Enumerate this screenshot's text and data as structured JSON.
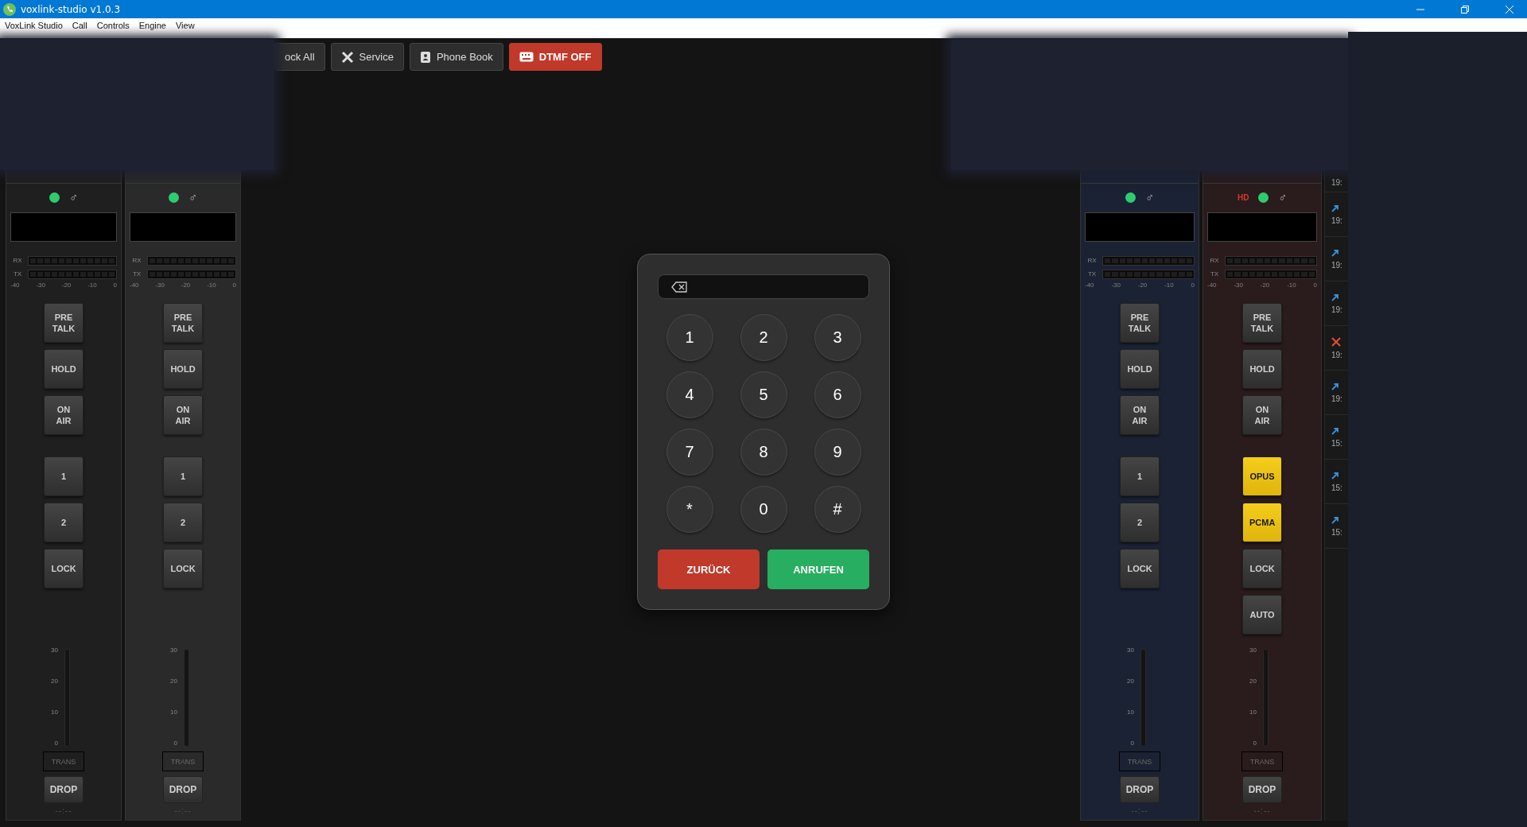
{
  "window": {
    "title": "voxlink-studio v1.0.3"
  },
  "menu": [
    "VoxLink Studio",
    "Call",
    "Controls",
    "Engine",
    "View"
  ],
  "toolbar": [
    {
      "label": "ock All",
      "kind": "plain"
    },
    {
      "label": "Service",
      "kind": "service"
    },
    {
      "label": "Phone Book",
      "kind": "phonebook"
    },
    {
      "label": "DTMF OFF",
      "kind": "dtmf"
    }
  ],
  "channels_left": [
    {
      "color": "#1f1f1f",
      "online": true,
      "user_symbol": "♂",
      "meters": [
        "RX",
        "TX"
      ],
      "scale": [
        "-40",
        "-30",
        "-20",
        "-10",
        "0"
      ],
      "call_buttons": [
        {
          "label": "PRE TALK",
          "highlighted": false
        },
        {
          "label": "HOLD",
          "highlighted": false
        },
        {
          "label": "ON AIR",
          "highlighted": false
        }
      ],
      "line_buttons": [
        {
          "label": "1",
          "highlighted": false
        },
        {
          "label": "2",
          "highlighted": false
        },
        {
          "label": "LOCK",
          "highlighted": false
        }
      ],
      "fader_ticks": [
        "30",
        "20",
        "10",
        "0"
      ],
      "trans": "TRANS",
      "drop": "DROP",
      "timer": "--:--"
    },
    {
      "color": "#2a2a2a",
      "online": true,
      "user_symbol": "♂",
      "meters": [
        "RX",
        "TX"
      ],
      "scale": [
        "-40",
        "-30",
        "-20",
        "-10",
        "0"
      ],
      "call_buttons": [
        {
          "label": "PRE TALK",
          "highlighted": false
        },
        {
          "label": "HOLD",
          "highlighted": false
        },
        {
          "label": "ON AIR",
          "highlighted": false
        }
      ],
      "line_buttons": [
        {
          "label": "1",
          "highlighted": false
        },
        {
          "label": "2",
          "highlighted": false
        },
        {
          "label": "LOCK",
          "highlighted": false
        }
      ],
      "fader_ticks": [
        "30",
        "20",
        "10",
        "0"
      ],
      "trans": "TRANS",
      "drop": "DROP",
      "timer": "--:--"
    }
  ],
  "dialpad": {
    "keys": [
      "1",
      "2",
      "3",
      "4",
      "5",
      "6",
      "7",
      "8",
      "9",
      "*",
      "0",
      "#"
    ],
    "back": "ZURÜCK",
    "call": "ANRUFEN"
  },
  "channels_right": [
    {
      "color": "#1b2233",
      "online": true,
      "user_symbol": "♂",
      "meters": [
        "RX",
        "TX"
      ],
      "scale": [
        "-40",
        "-30",
        "-20",
        "-10",
        "0"
      ],
      "call_buttons": [
        {
          "label": "PRE TALK",
          "highlighted": false
        },
        {
          "label": "HOLD",
          "highlighted": false
        },
        {
          "label": "ON AIR",
          "highlighted": false
        }
      ],
      "line_buttons": [
        {
          "label": "1",
          "highlighted": false
        },
        {
          "label": "2",
          "highlighted": false
        },
        {
          "label": "LOCK",
          "highlighted": false
        }
      ],
      "fader_ticks": [
        "30",
        "20",
        "10",
        "0"
      ],
      "trans": "TRANS",
      "drop": "DROP",
      "timer": "--:--"
    },
    {
      "color": "#2a1b1c",
      "hd_badge": "HD",
      "online": true,
      "user_symbol": "♂",
      "meters": [
        "RX",
        "TX"
      ],
      "scale": [
        "-40",
        "-30",
        "-20",
        "-10",
        "0"
      ],
      "call_buttons": [
        {
          "label": "PRE TALK",
          "highlighted": false
        },
        {
          "label": "HOLD",
          "highlighted": false
        },
        {
          "label": "ON AIR",
          "highlighted": false
        }
      ],
      "line_buttons": [
        {
          "label": "OPUS",
          "highlighted": true
        },
        {
          "label": "PCMA",
          "highlighted": true
        },
        {
          "label": "LOCK",
          "highlighted": false
        },
        {
          "label": "AUTO",
          "highlighted": false
        }
      ],
      "fader_ticks": [
        "30",
        "20",
        "10",
        "0"
      ],
      "trans": "TRANS",
      "drop": "DROP",
      "timer": "--:--"
    }
  ],
  "call_log": [
    {
      "time": "19:"
    },
    {
      "kind": "outgoing",
      "time": "19:"
    },
    {
      "kind": "outgoing",
      "time": "19:"
    },
    {
      "kind": "outgoing",
      "time": "19:"
    },
    {
      "kind": "missed",
      "time": "19:"
    },
    {
      "kind": "outgoing",
      "time": "19:"
    },
    {
      "kind": "outgoing",
      "time": "15:"
    },
    {
      "kind": "outgoing",
      "time": "15:"
    },
    {
      "kind": "outgoing",
      "time": "15:"
    }
  ]
}
